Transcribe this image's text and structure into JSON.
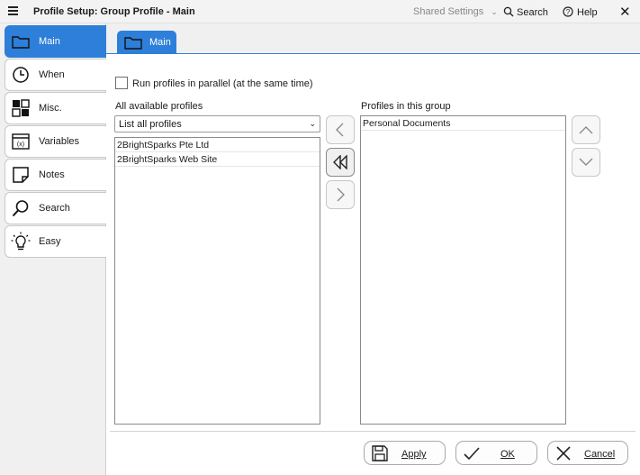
{
  "window": {
    "title": "Profile Setup: Group Profile - Main",
    "shared_settings": "Shared Settings",
    "search": "Search",
    "help": "Help"
  },
  "sidebar": {
    "items": [
      {
        "label": "Main",
        "icon": "folder-icon",
        "active": true
      },
      {
        "label": "When",
        "icon": "clock-icon"
      },
      {
        "label": "Misc.",
        "icon": "misc-grid-icon"
      },
      {
        "label": "Variables",
        "icon": "variables-icon"
      },
      {
        "label": "Notes",
        "icon": "note-icon"
      },
      {
        "label": "Search",
        "icon": "search-icon"
      },
      {
        "label": "Easy",
        "icon": "lightbulb-icon"
      }
    ]
  },
  "tabs": [
    {
      "label": "Main",
      "icon": "folder-icon",
      "active": true
    }
  ],
  "main": {
    "parallel_checkbox": {
      "label": "Run profiles in parallel (at the same time)",
      "checked": false
    },
    "available_label": "All available profiles",
    "filter_select": "List all profiles",
    "available_profiles": [
      "2BrightSparks Pte Ltd",
      "2BrightSparks Web Site"
    ],
    "group_label": "Profiles in this group",
    "group_profiles": [
      "Personal Documents"
    ]
  },
  "footer": {
    "apply": "Apply",
    "ok": "OK",
    "cancel": "Cancel"
  },
  "colors": {
    "accent": "#2e7fd9",
    "sidebar_bg": "#f0f0f0",
    "titlebar_bg": "#f3f3f3"
  }
}
